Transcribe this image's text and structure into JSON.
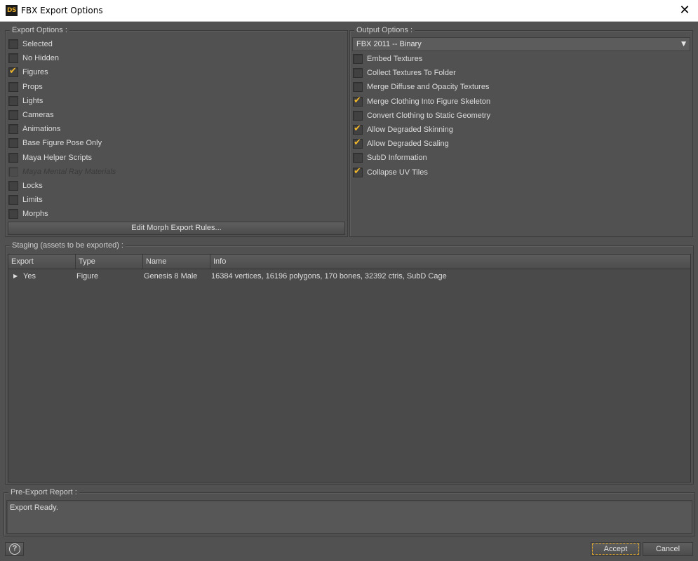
{
  "window": {
    "app_icon": "DS",
    "title": "FBX Export Options",
    "close_glyph": "✕"
  },
  "export_options": {
    "title": "Export Options :",
    "items": [
      {
        "label": "Selected",
        "checked": false,
        "enabled": true
      },
      {
        "label": "No Hidden",
        "checked": false,
        "enabled": true
      },
      {
        "label": "Figures",
        "checked": true,
        "enabled": true
      },
      {
        "label": "Props",
        "checked": false,
        "enabled": true
      },
      {
        "label": "Lights",
        "checked": false,
        "enabled": true
      },
      {
        "label": "Cameras",
        "checked": false,
        "enabled": true
      },
      {
        "label": "Animations",
        "checked": false,
        "enabled": true
      },
      {
        "label": "Base Figure Pose Only",
        "checked": false,
        "enabled": true
      },
      {
        "label": "Maya Helper Scripts",
        "checked": false,
        "enabled": true
      },
      {
        "label": "Maya Mental Ray Materials",
        "checked": false,
        "enabled": false
      },
      {
        "label": "Locks",
        "checked": false,
        "enabled": true
      },
      {
        "label": "Limits",
        "checked": false,
        "enabled": true
      },
      {
        "label": "Morphs",
        "checked": false,
        "enabled": true
      }
    ],
    "edit_morph_button": "Edit Morph Export Rules..."
  },
  "output_options": {
    "title": "Output Options :",
    "format_selected": "FBX 2011 -- Binary",
    "items": [
      {
        "label": "Embed Textures",
        "checked": false
      },
      {
        "label": "Collect Textures To Folder",
        "checked": false
      },
      {
        "label": "Merge Diffuse and Opacity Textures",
        "checked": false
      },
      {
        "label": "Merge Clothing Into Figure Skeleton",
        "checked": true
      },
      {
        "label": "Convert Clothing to Static Geometry",
        "checked": false
      },
      {
        "label": "Allow Degraded Skinning",
        "checked": true
      },
      {
        "label": "Allow Degraded Scaling",
        "checked": true
      },
      {
        "label": "SubD Information",
        "checked": false
      },
      {
        "label": "Collapse UV Tiles",
        "checked": true
      }
    ]
  },
  "staging": {
    "title": "Staging (assets to be exported) :",
    "columns": [
      "Export",
      "Type",
      "Name",
      "Info"
    ],
    "rows": [
      {
        "export": "Yes",
        "type": "Figure",
        "name": "Genesis 8 Male",
        "info": "16384 vertices, 16196 polygons, 170 bones, 32392 ctris, SubD Cage"
      }
    ]
  },
  "report": {
    "title": "Pre-Export Report :",
    "text": "Export Ready."
  },
  "footer": {
    "help_glyph": "?",
    "accept_label": "Accept",
    "cancel_label": "Cancel"
  },
  "colors": {
    "background": "#515151",
    "checkmark": "#f1b72b",
    "focus_outline": "#e0a82a"
  }
}
